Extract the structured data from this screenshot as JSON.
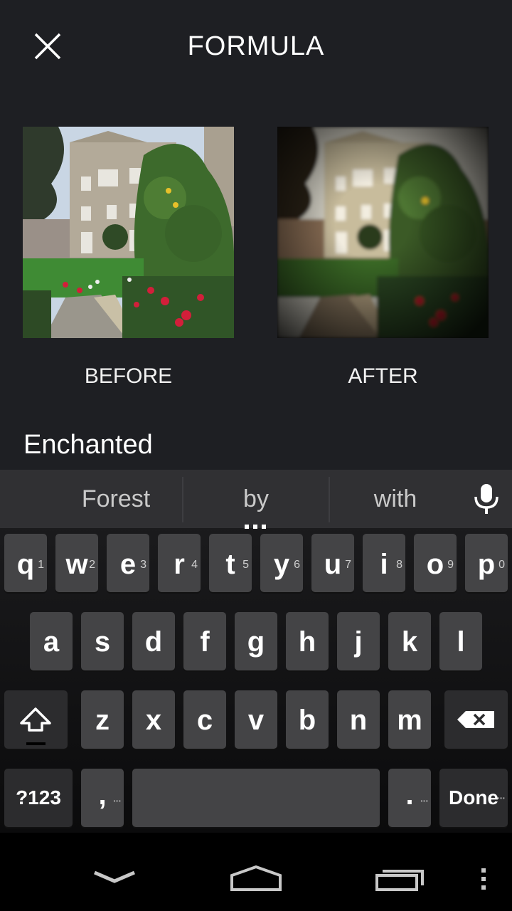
{
  "header": {
    "title": "FORMULA",
    "close_icon": "close-icon"
  },
  "preview": {
    "before_label": "BEFORE",
    "after_label": "AFTER"
  },
  "formula_name": {
    "value": "Enchanted"
  },
  "keyboard": {
    "suggestions": [
      "Forest",
      "by",
      "with"
    ],
    "mic_icon": "mic-icon",
    "row1": [
      {
        "label": "q",
        "hint": "1"
      },
      {
        "label": "w",
        "hint": "2"
      },
      {
        "label": "e",
        "hint": "3"
      },
      {
        "label": "r",
        "hint": "4"
      },
      {
        "label": "t",
        "hint": "5"
      },
      {
        "label": "y",
        "hint": "6"
      },
      {
        "label": "u",
        "hint": "7"
      },
      {
        "label": "i",
        "hint": "8"
      },
      {
        "label": "o",
        "hint": "9"
      },
      {
        "label": "p",
        "hint": "0"
      }
    ],
    "row2": [
      "a",
      "s",
      "d",
      "f",
      "g",
      "h",
      "j",
      "k",
      "l"
    ],
    "row3": [
      "z",
      "x",
      "c",
      "v",
      "b",
      "n",
      "m"
    ],
    "symbols_label": "?123",
    "comma_label": ",",
    "period_label": ".",
    "done_label": "Done"
  },
  "navbar": {
    "icons": [
      "back-icon",
      "home-icon",
      "recents-icon",
      "menu-icon"
    ]
  },
  "colors": {
    "background": "#1e1f23",
    "key": "#444446",
    "suggestion_bar": "#303033"
  }
}
